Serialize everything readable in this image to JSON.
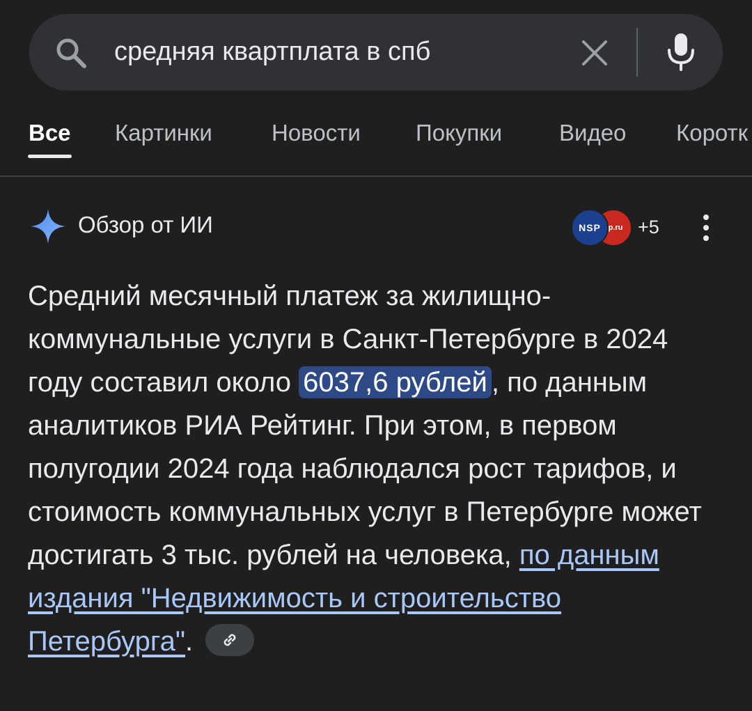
{
  "search": {
    "query": "средняя квартплата в спб"
  },
  "tabs": [
    {
      "label": "Все",
      "active": true
    },
    {
      "label": "Картинки",
      "active": false
    },
    {
      "label": "Новости",
      "active": false
    },
    {
      "label": "Покупки",
      "active": false
    },
    {
      "label": "Видео",
      "active": false
    },
    {
      "label": "Коротк",
      "active": false
    }
  ],
  "ai_overview": {
    "title": "Обзор от ИИ",
    "sources": {
      "logos": [
        "NSP",
        "p.ru"
      ],
      "more_count": "+5"
    },
    "text_part1": "Средний месячный платеж за жилищно-коммунальные услуги в Санкт-Петербурге в 2024 году составил около ",
    "highlight": "6037,6 рублей",
    "text_part2": ", по данным аналитиков РИА Рейтинг. При этом, в первом полугодии 2024 года наблюдался рост тарифов, и стоимость коммунальных услуг в Петербурге может достигать 3 тыс. рублей на человека, ",
    "link_text": "по данным издания \"Недвижимость и строительство Петербурга\"",
    "text_end": "."
  },
  "icons": {
    "search": "search-icon",
    "clear": "close-icon",
    "mic": "mic-icon",
    "sparkle": "gemini-sparkle-icon",
    "more": "more-vert-icon",
    "link": "link-icon"
  },
  "colors": {
    "background": "#1f1f1f",
    "search_bar": "#303134",
    "highlight": "#2d4a86",
    "link": "#a8c7fa"
  }
}
